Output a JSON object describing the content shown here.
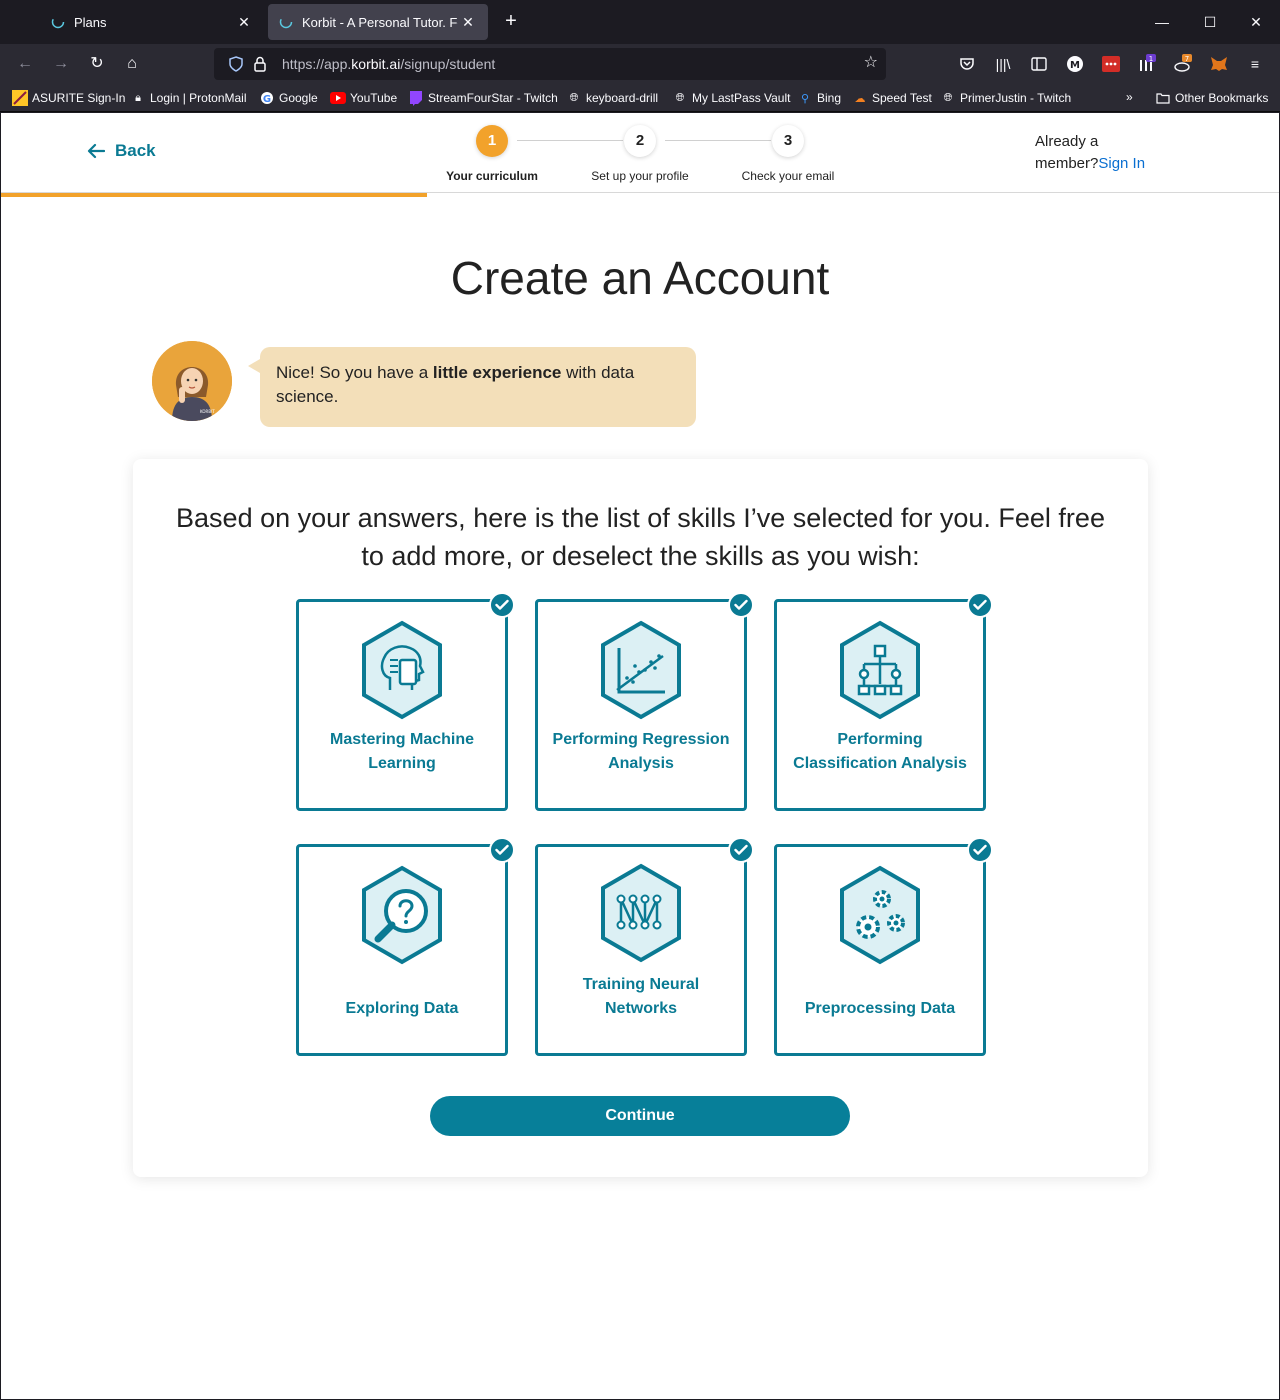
{
  "browser": {
    "tabs": [
      {
        "title": "Plans",
        "active": false
      },
      {
        "title": "Korbit - A Personal Tutor. For Ev",
        "active": true
      }
    ],
    "url_prefix": "https://app.",
    "url_domain": "korbit.ai",
    "url_path": "/signup/student",
    "bookmarks": [
      {
        "label": "ASURITE Sign-In",
        "icon": "asu-icon"
      },
      {
        "label": "Login | ProtonMail",
        "icon": "lock-icon"
      },
      {
        "label": "Google",
        "icon": "google-icon"
      },
      {
        "label": "YouTube",
        "icon": "youtube-icon"
      },
      {
        "label": "StreamFourStar - Twitch",
        "icon": "twitch-icon"
      },
      {
        "label": "keyboard-drill",
        "icon": "globe-icon"
      },
      {
        "label": "My LastPass Vault",
        "icon": "globe-icon"
      },
      {
        "label": "Bing",
        "icon": "search-icon"
      },
      {
        "label": "Speed Test",
        "icon": "cloud-icon"
      },
      {
        "label": "PrimerJustin - Twitch",
        "icon": "globe-icon"
      }
    ],
    "other_bookmarks": "Other Bookmarks",
    "badge_1": "1",
    "badge_7": "7"
  },
  "header": {
    "back_label": "Back",
    "steps": [
      {
        "num": "1",
        "label": "Your curriculum",
        "current": true
      },
      {
        "num": "2",
        "label": "Set up your profile",
        "current": false
      },
      {
        "num": "3",
        "label": "Check your email",
        "current": false
      }
    ],
    "already_member": "Already a member?",
    "already_line1": "Already a",
    "already_line2": "member?",
    "sign_in": "Sign In",
    "progress_fraction": 0.333
  },
  "main": {
    "title": "Create an Account",
    "bubble_pre": "Nice! So you have a ",
    "bubble_bold": "little experience",
    "bubble_post": " with data science.",
    "intro": "Based on your answers, here is the list of skills I’ve selected for you. Feel free to add more, or deselect the skills as you wish:",
    "skills": [
      {
        "line1": "Mastering Machine",
        "line2": "Learning",
        "icon": "ml-head-icon",
        "selected": true
      },
      {
        "line1": "Performing Regression",
        "line2": "Analysis",
        "icon": "regression-chart-icon",
        "selected": true
      },
      {
        "line1": "Performing",
        "line2": "Classification Analysis",
        "icon": "classification-tree-icon",
        "selected": true
      },
      {
        "line1": "",
        "line2": "Exploring Data",
        "icon": "magnifier-question-icon",
        "selected": true
      },
      {
        "line1": "Training Neural",
        "line2": "Networks",
        "icon": "neural-network-icon",
        "selected": true
      },
      {
        "line1": "",
        "line2": "Preprocessing Data",
        "icon": "gears-icon",
        "selected": true
      }
    ],
    "continue_label": "Continue"
  },
  "colors": {
    "teal": "#0a7a93",
    "orange": "#f2a22b",
    "bubble": "#f3dfb9"
  }
}
